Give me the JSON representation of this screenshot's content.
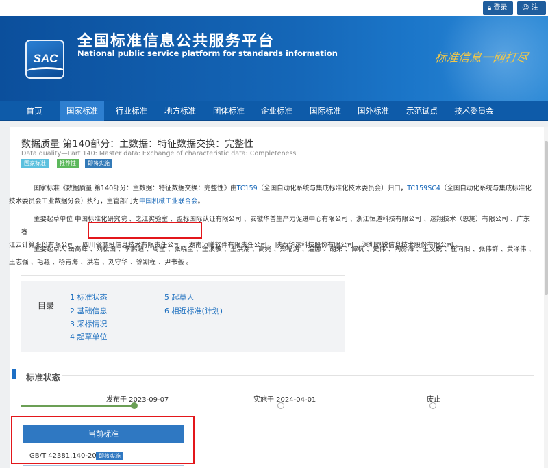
{
  "topbar": {
    "login": "登录",
    "register": "注册"
  },
  "header": {
    "logo_text": "SAC",
    "title_cn": "全国标准信息公共服务平台",
    "title_en": "National public service platform  for standards information",
    "slogan": "标准信息一网打尽"
  },
  "nav": [
    "首页",
    "国家标准",
    "行业标准",
    "地方标准",
    "团体标准",
    "企业标准",
    "国际标准",
    "国外标准",
    "示范试点",
    "技术委员会"
  ],
  "standard": {
    "title": "数据质量 第140部分：主数据：特征数据交换：完整性",
    "title_en": "Data quality—Part 140: Master data: Exchange of characteristic data: Completeness",
    "tags": [
      {
        "label": "国家标准",
        "color": "#5bc0de"
      },
      {
        "label": "推荐性",
        "color": "#5cb85c"
      },
      {
        "label": "即将实施",
        "color": "#337ab7"
      }
    ],
    "intro": {
      "line1_a": "国家标准《数据质量 第140部分：主数据：特征数据交换：完整性》由",
      "line1_tc": "TC159",
      "line1_b": "（全国自动化系统与集成标准化技术委员会）归口，",
      "line1_sc": "TC159SC4",
      "line1_c": "（全国自动化系统与集成标准化",
      "line2_a": "技术委员会工业数据分会）执行，主管部门为",
      "line2_dept": "中国机械工业联合会",
      "line2_b": "。"
    },
    "units_line1": "主要起草单位 中国标准化研究院 、之江实验室 、盟标国际认证有限公司 、安徽华普生产力促进中心有限公司 、浙江恒道科技有限公司 、达翔技术（恩施）有限公司 、广东睿",
    "units_line2": "江云计算股份有限公司 、四川省商投信息技术有限责任公司 、湖南迈曦软件有限责任公司 、陕西华达科技股份有限公司 、深圳鼎锐信息技术股份有限公司 。",
    "drafters_line1": "主要起草人 岳高峰 、刘松国 、李鹏超 、周莹 、张晓全 、王浪敏 、王洪潮 、高亮 、郑福涛 、温娜 、胡荣 、谭杭 、史伟 、陶影海 、王又锐 、崔向阳 、张伟群 、黄泽伟 、",
    "drafters_line2": "王志强 、毛淼 、杨青海 、洪岩 、刘守华 、徐凯程 、尹书荟 。"
  },
  "toc": {
    "heading": "目录",
    "items": [
      "1  标准状态",
      "2  基础信息",
      "3  采标情况",
      "4  起草单位",
      "5  起草人",
      "6  相近标准(计划)"
    ]
  },
  "status_section": {
    "heading": "标准状态",
    "published": "发布于 2023-09-07",
    "implemented": "实施于 2024-04-01",
    "abolished": "废止",
    "current_header": "当前标准",
    "current_code": "GB/T 42381.140-2023",
    "current_tag": "即将实施"
  }
}
